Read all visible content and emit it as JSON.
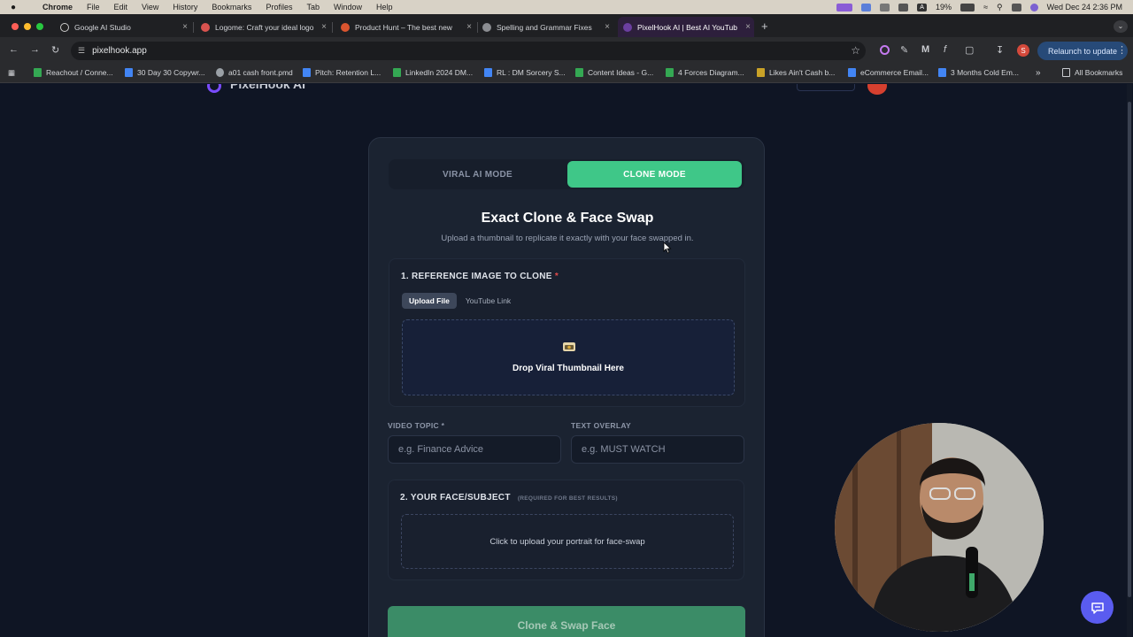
{
  "os_menu": {
    "app": "Chrome",
    "items": [
      "File",
      "Edit",
      "View",
      "History",
      "Bookmarks",
      "Profiles",
      "Tab",
      "Window",
      "Help"
    ],
    "battery": "19%",
    "datetime": "Wed Dec 24  2:36 PM"
  },
  "tabs": [
    {
      "title": "Google AI Studio",
      "color": "#e8e8e8"
    },
    {
      "title": "Logome: Craft your ideal logo",
      "color": "#d9534f"
    },
    {
      "title": "Product Hunt – The best new",
      "color": "#da552f"
    },
    {
      "title": "Spelling and Grammar Fixes",
      "color": "#a0a0a0"
    },
    {
      "title": "PixelHook AI | Best AI YouTub",
      "color": "#6b3fa0"
    }
  ],
  "toolbar": {
    "url": "pixelhook.app",
    "relaunch_label": "Relaunch to update",
    "profile_initial": "S"
  },
  "bookmarks": [
    {
      "label": "Reachout / Conne...",
      "color": "#34a853"
    },
    {
      "label": "30 Day 30 Copywr...",
      "color": "#4285f4"
    },
    {
      "label": "a01 cash front.pmd",
      "color": "#9aa0a6"
    },
    {
      "label": "Pitch: Retention L...",
      "color": "#4285f4"
    },
    {
      "label": "LinkedIn 2024 DM...",
      "color": "#34a853"
    },
    {
      "label": "RL : DM Sorcery S...",
      "color": "#4285f4"
    },
    {
      "label": "Content Ideas - G...",
      "color": "#34a853"
    },
    {
      "label": "4 Forces Diagram...",
      "color": "#34a853"
    },
    {
      "label": "Likes Ain't Cash b...",
      "color": "#c9a227"
    },
    {
      "label": "eCommerce Email...",
      "color": "#4285f4"
    },
    {
      "label": "3 Months Cold Em...",
      "color": "#4285f4"
    }
  ],
  "bookmarks_more": "»",
  "all_bookmarks": "All Bookmarks",
  "site": {
    "name": "PixelHook AI"
  },
  "modes": {
    "viral": "VIRAL AI MODE",
    "clone": "CLONE MODE"
  },
  "header": {
    "title": "Exact Clone & Face Swap",
    "subtitle": "Upload a thumbnail to replicate it exactly with your face swapped in."
  },
  "reference": {
    "label": "1. REFERENCE IMAGE TO CLONE",
    "required_mark": "*",
    "tab_upload": "Upload File",
    "tab_youtube": "YouTube Link",
    "drop_text": "Drop Viral Thumbnail Here"
  },
  "fields": {
    "video_topic_label": "VIDEO TOPIC",
    "video_topic_required": "*",
    "video_topic_placeholder": "e.g. Finance Advice",
    "text_overlay_label": "TEXT OVERLAY",
    "text_overlay_placeholder": "e.g. MUST WATCH"
  },
  "face": {
    "label": "2. YOUR FACE/SUBJECT",
    "note": "(REQUIRED FOR BEST RESULTS)",
    "drop_text": "Click to upload your portrait for face-swap"
  },
  "submit_label": "Clone & Swap Face",
  "colors": {
    "accent_green": "#3fc788",
    "page_bg": "#0f1524",
    "card_bg": "#1b2331",
    "chat_button": "#5a5cf0"
  }
}
